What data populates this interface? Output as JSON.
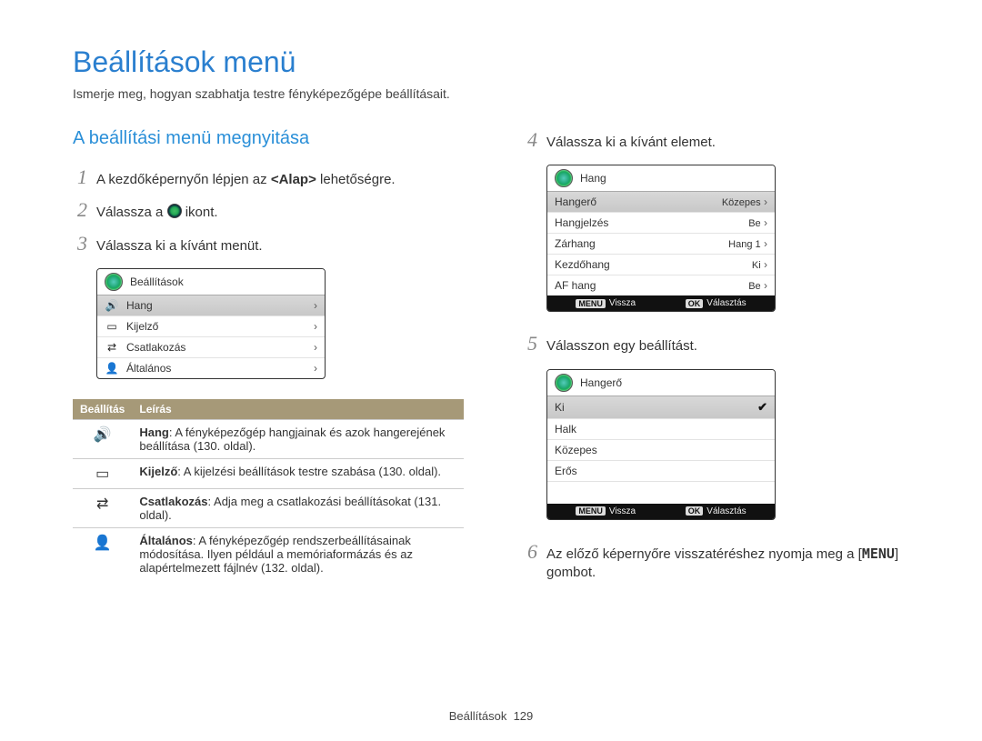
{
  "title": "Beállítások menü",
  "subtitle": "Ismerje meg, hogyan szabhatja testre fényképezőgépe beállításait.",
  "section_head": "A beállítási menü megnyitása",
  "steps_left": {
    "s1_pre": "A kezdőképernyőn lépjen az ",
    "s1_bold": "<Alap>",
    "s1_post": " lehetőségre.",
    "s2_pre": "Válassza a ",
    "s2_post": " ikont.",
    "s3": "Válassza ki a kívánt menüt."
  },
  "panel1": {
    "title": "Beállítások",
    "rows": [
      {
        "icon": "🔊",
        "label": "Hang"
      },
      {
        "icon": "▭",
        "label": "Kijelző"
      },
      {
        "icon": "⇄",
        "label": "Csatlakozás"
      },
      {
        "icon": "👤",
        "label": "Általános"
      }
    ]
  },
  "desc_table": {
    "h1": "Beállítás",
    "h2": "Leírás",
    "rows": [
      {
        "icon": "🔊",
        "name": "Hang",
        "text": ": A fényképezőgép hangjainak és azok hangerejének beállítása (130. oldal)."
      },
      {
        "icon": "▭",
        "name": "Kijelző",
        "text": ": A kijelzési beállítások testre szabása (130. oldal)."
      },
      {
        "icon": "⇄",
        "name": "Csatlakozás",
        "text": ": Adja meg a csatlakozási beállításokat (131. oldal)."
      },
      {
        "icon": "👤",
        "name": "Általános",
        "text": ": A fényképezőgép rendszerbeállításainak módosítása. Ilyen például a memóriaformázás és az alapértelmezett fájlnév (132. oldal)."
      }
    ]
  },
  "steps_right": {
    "s4": "Válassza ki a kívánt elemet.",
    "s5": "Válasszon egy beállítást.",
    "s6_pre": "Az előző képernyőre visszatéréshez nyomja meg a [",
    "s6_key": "MENU",
    "s6_post": "] gombot."
  },
  "panel2": {
    "title": "Hang",
    "rows": [
      {
        "label": "Hangerő",
        "value": "Közepes",
        "selected": true,
        "chev": true
      },
      {
        "label": "Hangjelzés",
        "value": "Be",
        "chev": true
      },
      {
        "label": "Zárhang",
        "value": "Hang 1",
        "chev": true
      },
      {
        "label": "Kezdőhang",
        "value": "Ki",
        "chev": true
      },
      {
        "label": "AF hang",
        "value": "Be",
        "chev": true
      }
    ],
    "footer_back": "Vissza",
    "footer_ok": "Választás"
  },
  "panel3": {
    "title": "Hangerő",
    "rows": [
      {
        "label": "Ki",
        "selected": true,
        "check": true
      },
      {
        "label": "Halk"
      },
      {
        "label": "Közepes"
      },
      {
        "label": "Erős"
      }
    ],
    "footer_back": "Vissza",
    "footer_ok": "Választás"
  },
  "footer": {
    "label": "Beállítások",
    "page": "129"
  },
  "keys": {
    "menu": "MENU",
    "ok": "OK"
  }
}
